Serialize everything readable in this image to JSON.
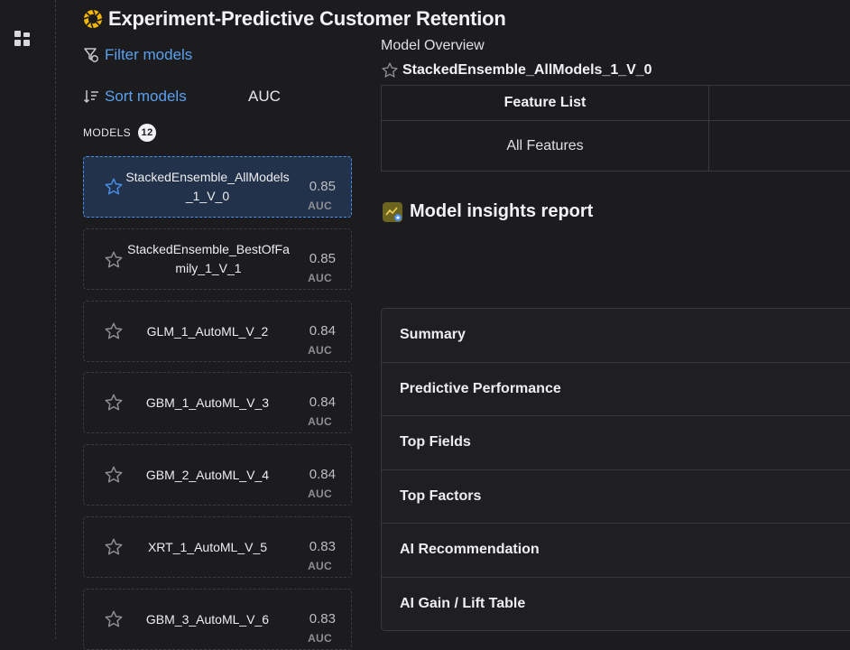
{
  "header": {
    "title": "Experiment-Predictive Customer Retention",
    "logo_icon": "aperture-icon"
  },
  "controls": {
    "filter_label": "Filter models",
    "sort_label": "Sort models",
    "sort_value": "AUC"
  },
  "models": {
    "label": "MODELS",
    "count": "12",
    "items": [
      {
        "name": "StackedEnsemble_AllModels_1_V_0",
        "score": "0.85",
        "metric": "AUC",
        "selected": true
      },
      {
        "name": "StackedEnsemble_BestOfFamily_1_V_1",
        "score": "0.85",
        "metric": "AUC"
      },
      {
        "name": "GLM_1_AutoML_V_2",
        "score": "0.84",
        "metric": "AUC"
      },
      {
        "name": "GBM_1_AutoML_V_3",
        "score": "0.84",
        "metric": "AUC"
      },
      {
        "name": "GBM_2_AutoML_V_4",
        "score": "0.84",
        "metric": "AUC"
      },
      {
        "name": "XRT_1_AutoML_V_5",
        "score": "0.83",
        "metric": "AUC"
      },
      {
        "name": "GBM_3_AutoML_V_6",
        "score": "0.83",
        "metric": "AUC"
      }
    ]
  },
  "overview": {
    "label": "Model Overview",
    "model_name": "StackedEnsemble_AllModels_1_V_0",
    "feature_list_header": "Feature List",
    "feature_list_value": "All Features"
  },
  "insights": {
    "title": "Model insights report",
    "sections": [
      "Summary",
      "Predictive Performance",
      "Top Fields",
      "Top Factors",
      "AI Recommendation",
      "AI Gain / Lift Table"
    ]
  },
  "colors": {
    "accent": "#5aa0f0",
    "selected_bg": "#22324a",
    "logo": "#f5b700",
    "background": "#1c1c1e"
  }
}
